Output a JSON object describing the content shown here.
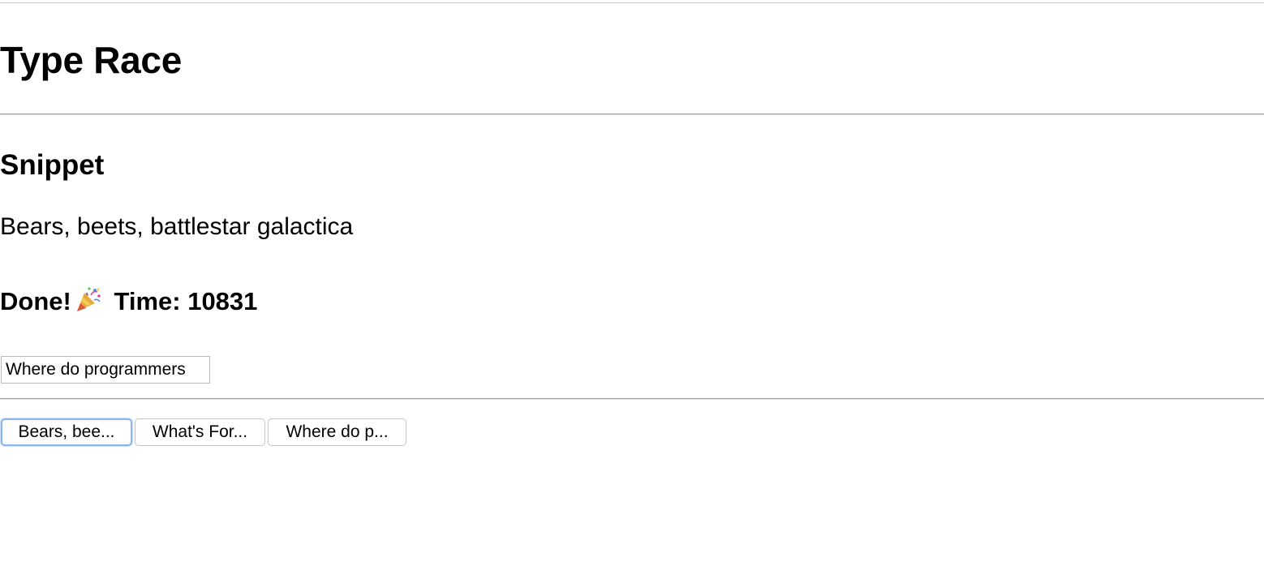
{
  "app": {
    "title": "Type Race"
  },
  "snippet": {
    "heading": "Snippet",
    "text": "Bears, beets, battlestar galactica"
  },
  "status": {
    "done_text": "Done!",
    "celebration_icon": "party-popper-icon",
    "time_label": "Time:",
    "time_value": "10831"
  },
  "input": {
    "value": "Where do programmers"
  },
  "snippet_buttons": [
    {
      "label": "Bears, bee...",
      "focused": true
    },
    {
      "label": "What's For..."
    },
    {
      "label": "Where do p..."
    }
  ],
  "colors": {
    "focus_ring": "#8ab6ef",
    "divider": "#9a9a9a"
  }
}
